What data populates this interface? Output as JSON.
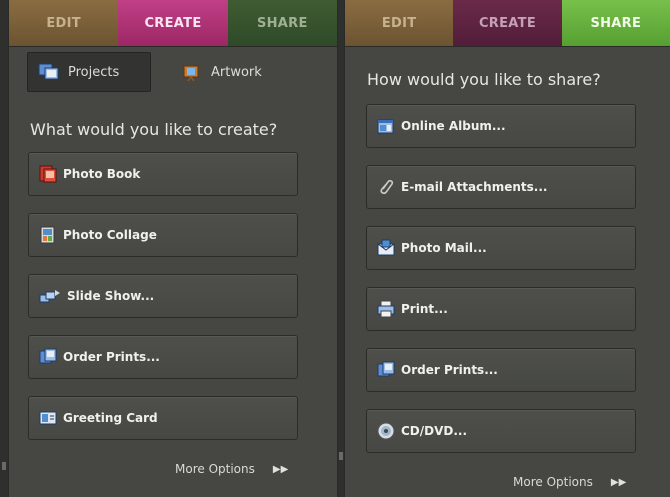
{
  "left": {
    "tabs": {
      "edit": "EDIT",
      "create": "CREATE",
      "share": "SHARE"
    },
    "subtabs": {
      "projects": "Projects",
      "artwork": "Artwork"
    },
    "heading": "What would you like to create?",
    "buttons": [
      "Photo Book",
      "Photo Collage",
      "Slide Show...",
      "Order Prints...",
      "Greeting Card"
    ],
    "more_options": "More Options"
  },
  "right": {
    "tabs": {
      "edit": "EDIT",
      "create": "CREATE",
      "share": "SHARE"
    },
    "heading": "How would you like to share?",
    "buttons": [
      "Online Album...",
      "E-mail Attachments...",
      "Photo Mail...",
      "Print...",
      "Order Prints...",
      "CD/DVD..."
    ],
    "more_options": "More Options"
  },
  "colors": {
    "edit_tab": "#7a5f39",
    "create_tab_active": "#b3347a",
    "share_tab_active": "#6ab240",
    "panel_bg": "#464743"
  }
}
